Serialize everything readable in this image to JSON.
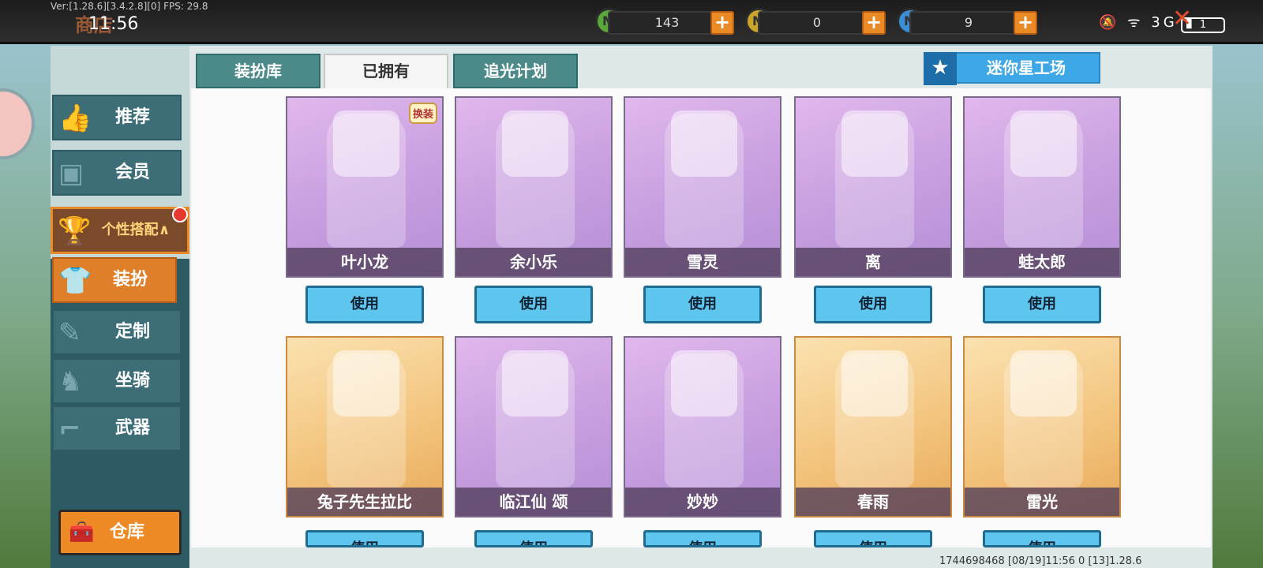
{
  "status_bar": {
    "version": "Ver:[1.28.6][3.4.2.8][0] FPS: 29.8",
    "screen_title_ghost": "商店",
    "time": "11:56",
    "battery": "1",
    "currencies": [
      {
        "icon": "mini-bean-green-coin",
        "value": "143"
      },
      {
        "icon": "mini-coin-gold",
        "value": "0"
      },
      {
        "icon": "mini-point-blue-coin",
        "value": "9"
      }
    ],
    "plus_label": "+",
    "system_icons": "🔕 ᯤ 3G ▮"
  },
  "tabs": [
    {
      "label": "装扮库",
      "active": false
    },
    {
      "label": "已拥有",
      "active": true
    },
    {
      "label": "追光计划",
      "active": false
    }
  ],
  "studio_button": "迷你星工场",
  "sidebar": {
    "items": [
      {
        "label": "推荐",
        "icon": "thumbs-up-icon"
      },
      {
        "label": "会员",
        "icon": "member-icon"
      },
      {
        "label": "个性搭配",
        "icon": "trophy-icon",
        "expanded_marker": "∧"
      },
      {
        "label": "装扮",
        "icon": "shirt-icon",
        "active": true
      },
      {
        "label": "定制",
        "icon": "pencil-icon"
      },
      {
        "label": "坐骑",
        "icon": "mount-icon"
      },
      {
        "label": "武器",
        "icon": "gun-icon"
      }
    ],
    "warehouse": "仓库"
  },
  "skins_row1": [
    {
      "name": "叶小龙",
      "style": "purple",
      "badge": "换装"
    },
    {
      "name": "余小乐",
      "style": "purple"
    },
    {
      "name": "雪灵",
      "style": "purple"
    },
    {
      "name": "离",
      "style": "purple"
    },
    {
      "name": "蛙太郎",
      "style": "purple"
    }
  ],
  "skins_row2": [
    {
      "name": "兔子先生拉比",
      "style": "orange"
    },
    {
      "name": "临江仙 颂",
      "style": "purple"
    },
    {
      "name": "妙妙",
      "style": "purple"
    },
    {
      "name": "春雨",
      "style": "orange"
    },
    {
      "name": "雷光",
      "style": "orange"
    }
  ],
  "use_label": "使用",
  "footer_info": "1744698468   [08/19]11:56 0    [13]1.28.6",
  "colors": {
    "accent_orange": "#ee8a26",
    "tab_teal": "#4c8a8a",
    "use_blue": "#5ec5ef"
  }
}
